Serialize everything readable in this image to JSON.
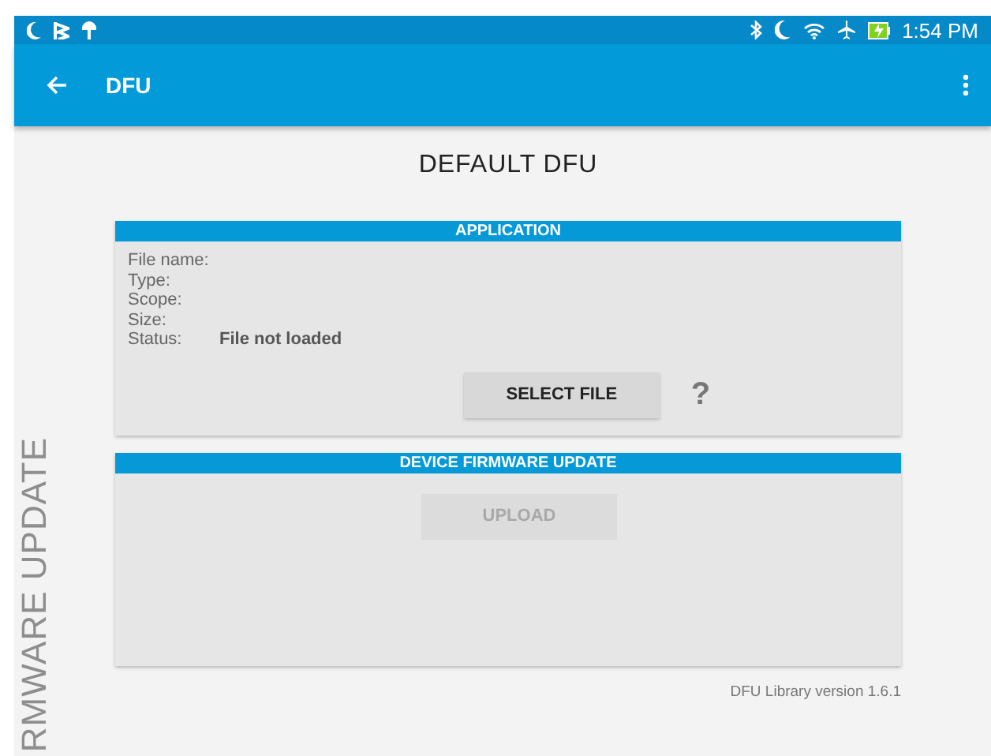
{
  "status_bar": {
    "time": "1:54 PM"
  },
  "app_bar": {
    "title": "DFU"
  },
  "page_title": "DEFAULT DFU",
  "side_label": "RMWARE UPDATE",
  "application": {
    "header": "APPLICATION",
    "fields": [
      {
        "label": "File name:"
      },
      {
        "label": "Type:"
      },
      {
        "label": "Scope:"
      },
      {
        "label": "Size:"
      },
      {
        "label": "Status:",
        "value": "File not loaded"
      }
    ],
    "select_button": {
      "label": "SELECT FILE",
      "disabled": false
    },
    "help": "?"
  },
  "firmware_update": {
    "header": "DEVICE FIRMWARE UPDATE",
    "upload_button": {
      "label": "UPLOAD",
      "disabled": true
    }
  },
  "footer": "DFU Library version 1.6.1"
}
